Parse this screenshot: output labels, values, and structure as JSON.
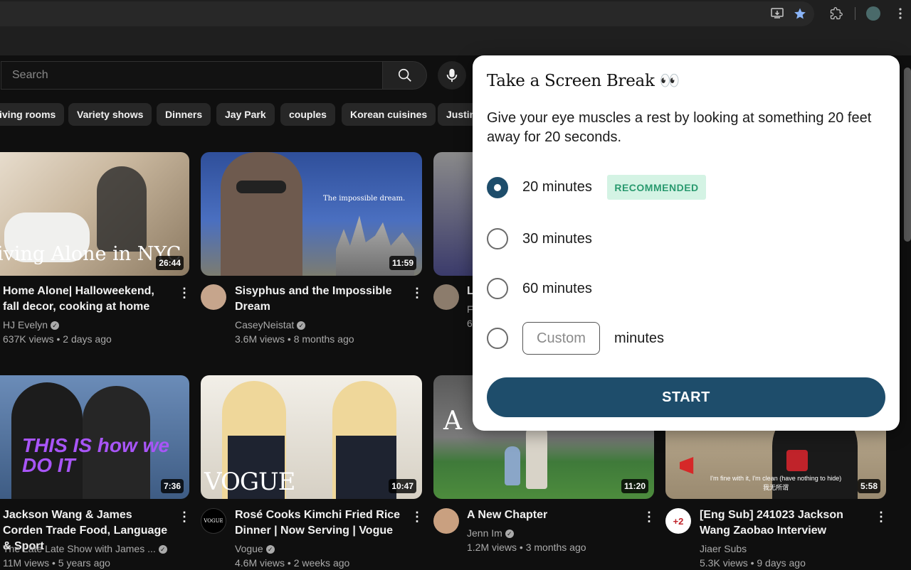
{
  "search": {
    "placeholder": "Search"
  },
  "chips": [
    "iving rooms",
    "Variety shows",
    "Dinners",
    "Jay Park",
    "couples",
    "Korean cuisines",
    "Justin"
  ],
  "videos": [
    {
      "title": "Home Alone| Halloweekend, fall decor, cooking at home",
      "channel": "HJ Evelyn",
      "meta": "637K views • 2 days ago",
      "duration": "26:44",
      "overlay": "iving Alone in NYC"
    },
    {
      "title": "Sisyphus and the Impossible Dream",
      "channel": "CaseyNeistat",
      "meta": "3.6M views • 8 months ago",
      "duration": "11:59",
      "overlay": "The impossible dream."
    },
    {
      "title": "L",
      "channel": "F",
      "meta": "6"
    },
    {
      "title": "Jackson Wang & James Corden Trade Food, Language & Sport",
      "channel": "The Late Late Show with James ...",
      "meta": "11M views • 5 years ago",
      "duration": "7:36",
      "overlay": "THIS IS how we DO IT"
    },
    {
      "title": "Rosé Cooks Kimchi Fried Rice Dinner | Now Serving | Vogue",
      "channel": "Vogue",
      "meta": "4.6M views • 2 weeks ago",
      "duration": "10:47",
      "overlay": "VOGUE"
    },
    {
      "title": "A New Chapter",
      "channel": "Jenn Im",
      "meta": "1.2M views • 3 months ago",
      "duration": "11:20",
      "overlay": "A"
    },
    {
      "title": "[Eng Sub] 241023 Jackson Wang Zaobao Interview",
      "channel": "Jiaer Subs",
      "meta": "5.3K views • 9 days ago",
      "duration": "5:58",
      "overlay": "I'm fine with it, I'm clean (have nothing to hide)",
      "overlay_sub": "我无所谓",
      "avatar_text": "+2"
    }
  ],
  "popup": {
    "title": "Take a Screen Break 👀",
    "description": "Give your eye muscles a rest by looking at something 20 feet away for 20 seconds.",
    "options": [
      {
        "label": "20 minutes",
        "selected": true
      },
      {
        "label": "30 minutes",
        "selected": false
      },
      {
        "label": "60 minutes",
        "selected": false
      }
    ],
    "recommended_badge": "RECOMMENDED",
    "custom_placeholder": "Custom",
    "custom_unit": "minutes",
    "start_label": "START"
  },
  "colors": {
    "accent": "#1e4d6b",
    "badge_bg": "#d4f3e4",
    "badge_fg": "#2a9a6f"
  }
}
